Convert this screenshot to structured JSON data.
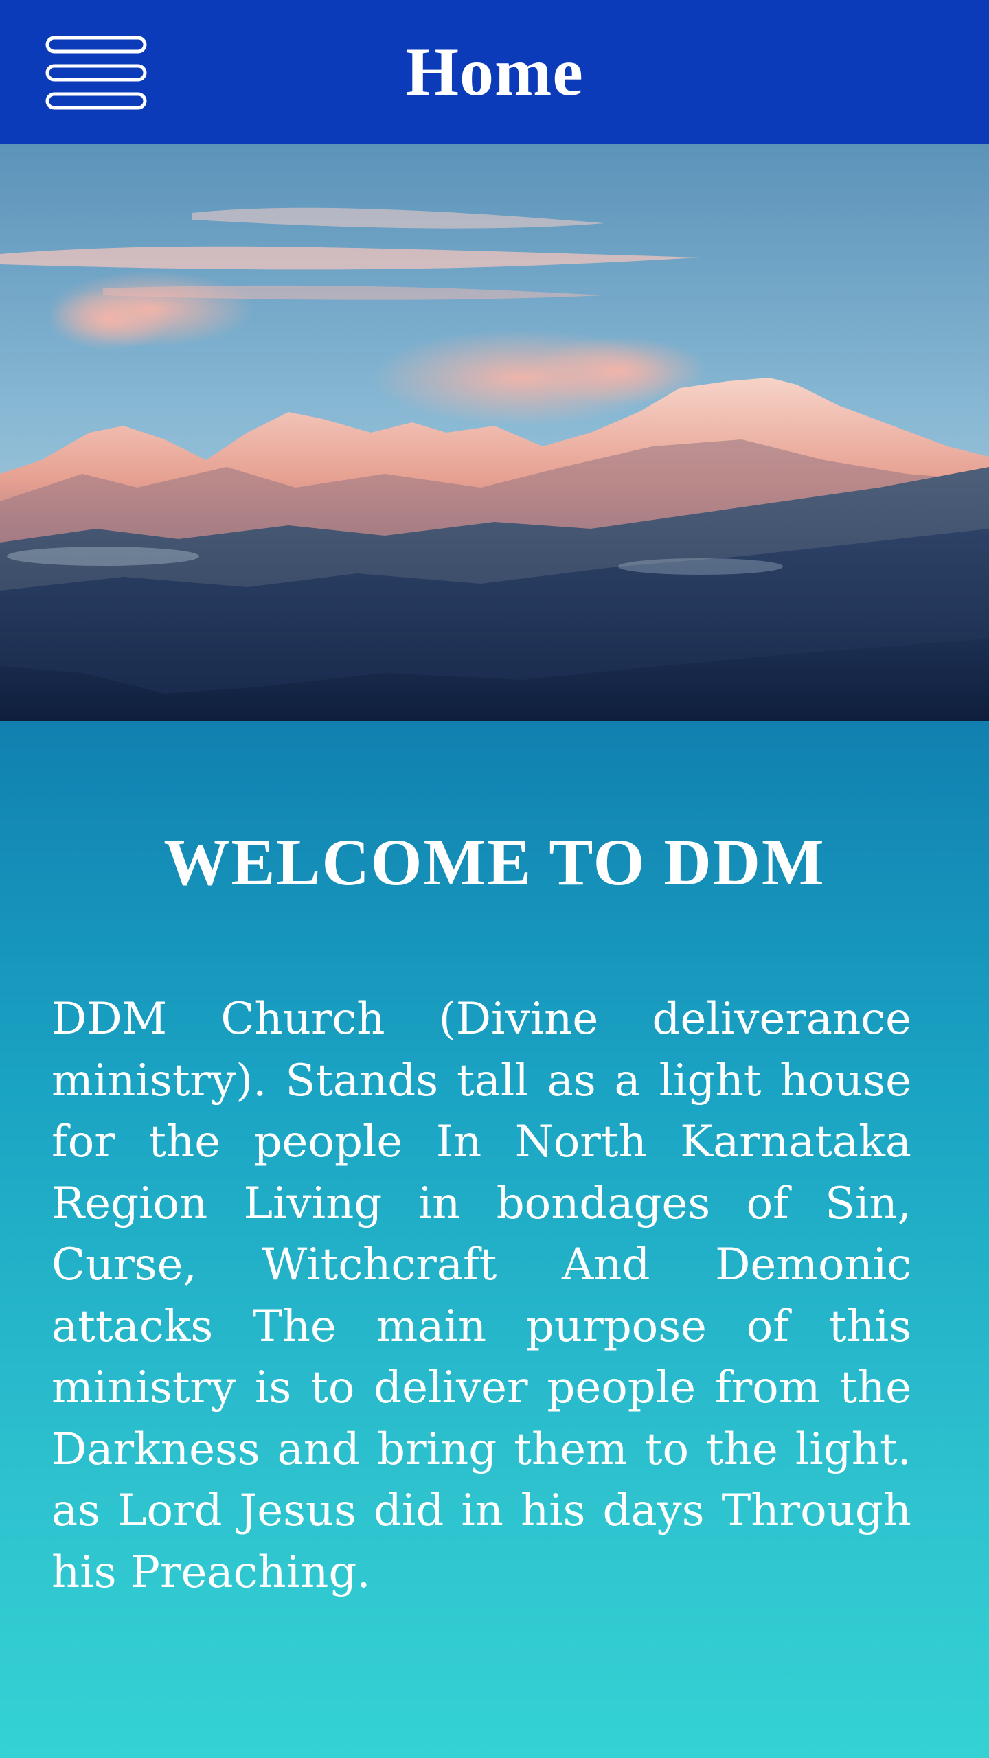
{
  "header": {
    "title": "Home",
    "menu_icon": "hamburger-menu-icon",
    "background_color": "#0b3bb8"
  },
  "hero": {
    "description": "mountain-landscape-image"
  },
  "main": {
    "heading": "WELCOME TO DDM",
    "body": "DDM Church (Divine deliverance ministry). Stands tall as a light house for the people In North Karnataka Region Living in bondages of Sin, Curse, Witchcraft And Demonic attacks The main purpose of this ministry is to deliver people from the Darkness and bring them to the light. as Lord Jesus did in his days Through his Preaching.",
    "gradient_top": "#1180b0",
    "gradient_bottom": "#34d2d4"
  }
}
